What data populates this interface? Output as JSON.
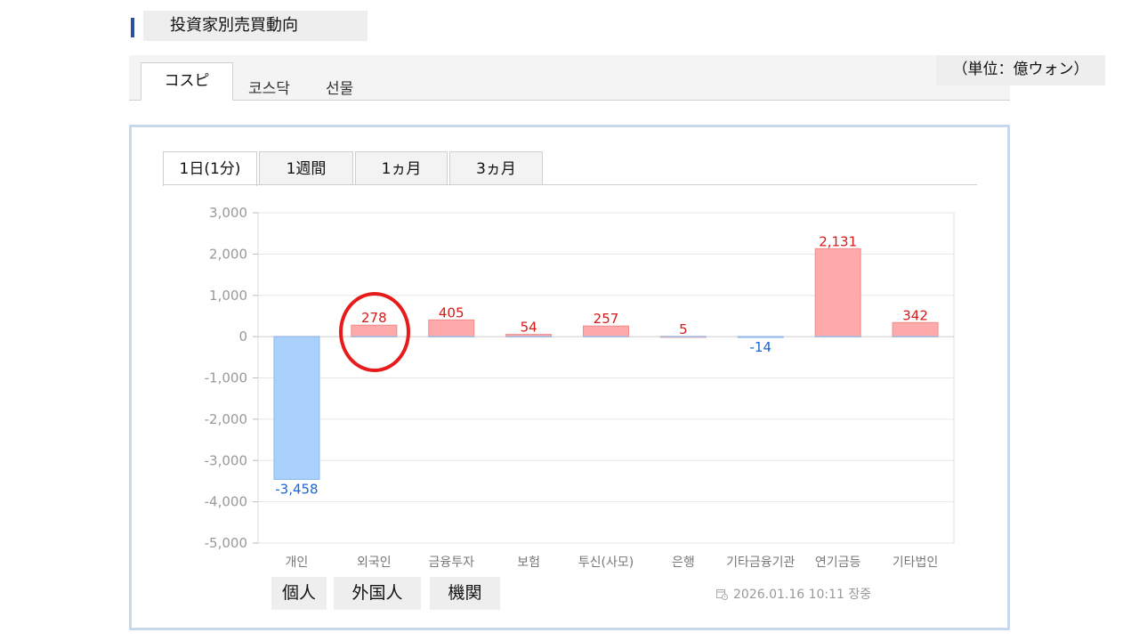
{
  "header": {
    "title": "投資家別売買動向"
  },
  "market_tabs": [
    {
      "label": "コスピ",
      "active": true
    },
    {
      "label": "코스닥",
      "active": false
    },
    {
      "label": "선물",
      "active": false
    }
  ],
  "unit_label": "（単位：億ウォン）",
  "period_tabs": [
    {
      "label": "1日(1分)",
      "active": true
    },
    {
      "label": "1週間",
      "active": false
    },
    {
      "label": "1ヵ月",
      "active": false
    },
    {
      "label": "3ヵ月",
      "active": false
    }
  ],
  "investor_tabs": [
    {
      "label": "個人"
    },
    {
      "label": "外国人"
    },
    {
      "label": "機関"
    }
  ],
  "timestamp": "2026.01.16 10:11 장중",
  "colors": {
    "positive_fill": "#ffaaaa",
    "positive_text": "#d81818",
    "negative_fill": "#a9d1fb",
    "negative_text": "#1a66d6",
    "annotation": "#e81b1b"
  },
  "chart_data": {
    "type": "bar",
    "categories": [
      "개인",
      "외국인",
      "금융투자",
      "보험",
      "투신(사모)",
      "은행",
      "기타금융기관",
      "연기금등",
      "기타법인"
    ],
    "values": [
      -3458,
      278,
      405,
      54,
      257,
      5,
      -14,
      2131,
      342
    ],
    "data_labels": [
      "-3,458",
      "278",
      "405",
      "54",
      "257",
      "5",
      "-14",
      "2,131",
      "342"
    ],
    "y_ticks": [
      "3,000",
      "2,000",
      "1,000",
      "0",
      "-1,000",
      "-2,000",
      "-3,000",
      "-4,000",
      "-5,000"
    ],
    "y_tick_values": [
      3000,
      2000,
      1000,
      0,
      -1000,
      -2000,
      -3000,
      -4000,
      -5000
    ],
    "ylim": [
      -5000,
      3000
    ],
    "grid": true,
    "highlight_category": "외국인"
  }
}
